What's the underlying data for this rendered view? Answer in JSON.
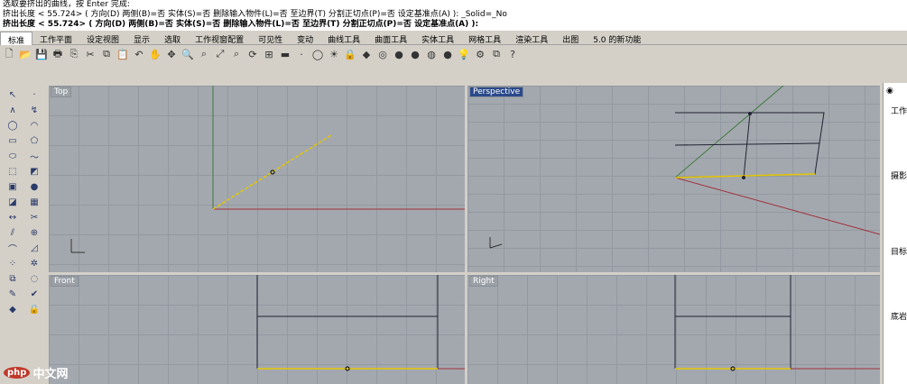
{
  "command_history": [
    "选取要挤出的曲线，按 Enter 完成:",
    "挤出长度 < 55.724> ( 方向(D)  两侧(B)=否  实体(S)=否  删除输入物件(L)=否  至边界(T)  分割正切点(P)=否  设定基准点(A) ): _Solid=_No"
  ],
  "command_prompt": "挤出长度 < 55.724> ( 方向(D)  两侧(B)=否  实体(S)=否  删除输入物件(L)=否  至边界(T)  分割正切点(P)=否  设定基准点(A) ):",
  "tabs": [
    "标准",
    "工作平面",
    "设定视图",
    "显示",
    "选取",
    "工作视窗配置",
    "可见性",
    "变动",
    "曲线工具",
    "曲面工具",
    "实体工具",
    "网格工具",
    "渲染工具",
    "出图",
    "5.0 的新功能"
  ],
  "toolbar_icons": [
    "new-file",
    "open-folder",
    "save",
    "print",
    "import",
    "cut",
    "copy",
    "paste",
    "undo",
    "pan-hand",
    "move",
    "zoom",
    "zoom-window",
    "zoom-extents",
    "zoom-selected",
    "rotate-view",
    "four-viewports",
    "properties",
    "point",
    "circle",
    "light",
    "lock",
    "render",
    "color",
    "shaded-sphere",
    "rendered-sphere",
    "ghosted-sphere",
    "blue-sphere",
    "lightbulb",
    "rhino-options",
    "group",
    "help"
  ],
  "sidebar_icons": [
    "select-arrow",
    "point",
    "polyline",
    "curve",
    "circle",
    "arc",
    "rectangle",
    "polygon",
    "ellipse",
    "freeform",
    "extrude",
    "surface",
    "box",
    "sphere",
    "solid-edit",
    "mesh",
    "dimension",
    "trim",
    "split",
    "join",
    "fillet",
    "chamfer",
    "array",
    "explode",
    "group",
    "hide",
    "analyze",
    "check",
    "render",
    "lock"
  ],
  "viewports": [
    {
      "name": "Top",
      "active": false
    },
    {
      "name": "Perspective",
      "active": true
    },
    {
      "name": "Front",
      "active": false
    },
    {
      "name": "Right",
      "active": false
    }
  ],
  "right_panel": {
    "items": [
      "工作",
      "摄影",
      "目标",
      "底岩"
    ]
  },
  "watermark": {
    "logo": "php",
    "text": "中文网"
  }
}
